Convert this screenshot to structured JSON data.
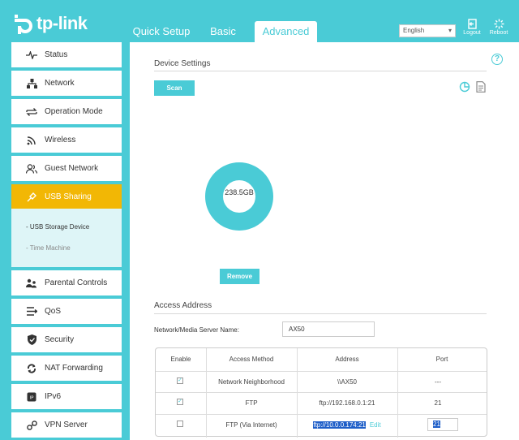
{
  "header": {
    "logo_text": "tp-link",
    "tabs": [
      {
        "label": "Quick Setup"
      },
      {
        "label": "Basic"
      },
      {
        "label": "Advanced"
      }
    ],
    "language": "English",
    "logout_label": "Logout",
    "reboot_label": "Reboot"
  },
  "sidebar": {
    "items": [
      {
        "label": "Status",
        "icon": "pulse-icon"
      },
      {
        "label": "Network",
        "icon": "network-icon"
      },
      {
        "label": "Operation Mode",
        "icon": "swap-icon"
      },
      {
        "label": "Wireless",
        "icon": "wifi-icon"
      },
      {
        "label": "Guest Network",
        "icon": "guest-icon"
      },
      {
        "label": "USB Sharing",
        "icon": "usb-icon",
        "active": true
      },
      {
        "label": "Parental Controls",
        "icon": "family-icon"
      },
      {
        "label": "QoS",
        "icon": "qos-icon"
      },
      {
        "label": "Security",
        "icon": "shield-icon"
      },
      {
        "label": "NAT Forwarding",
        "icon": "nat-icon"
      },
      {
        "label": "IPv6",
        "icon": "ipv6-icon"
      },
      {
        "label": "VPN Server",
        "icon": "vpn-icon"
      }
    ],
    "sub_items": [
      {
        "label": "- USB Storage Device"
      },
      {
        "label": "- Time Machine"
      }
    ]
  },
  "main": {
    "device_settings_title": "Device Settings",
    "scan_label": "Scan",
    "storage_label": "238.5GB",
    "remove_label": "Remove",
    "access_address_title": "Access Address",
    "server_name_label": "Network/Media Server Name:",
    "server_name_value": "AX50",
    "table": {
      "headers": [
        "Enable",
        "Access Method",
        "Address",
        "Port"
      ],
      "rows": [
        {
          "enabled": true,
          "method": "Network Neighborhood",
          "address": "\\\\AX50",
          "port": "---"
        },
        {
          "enabled": true,
          "method": "FTP",
          "address": "ftp://192.168.0.1:21",
          "port": "21"
        },
        {
          "enabled": false,
          "method": "FTP (Via Internet)",
          "address": "ftp://10.0.0.174:21",
          "edit": "Edit",
          "port": "21"
        }
      ]
    }
  },
  "colors": {
    "accent": "#4acbd6",
    "active": "#f2b705",
    "selection": "#1e5ec8"
  }
}
